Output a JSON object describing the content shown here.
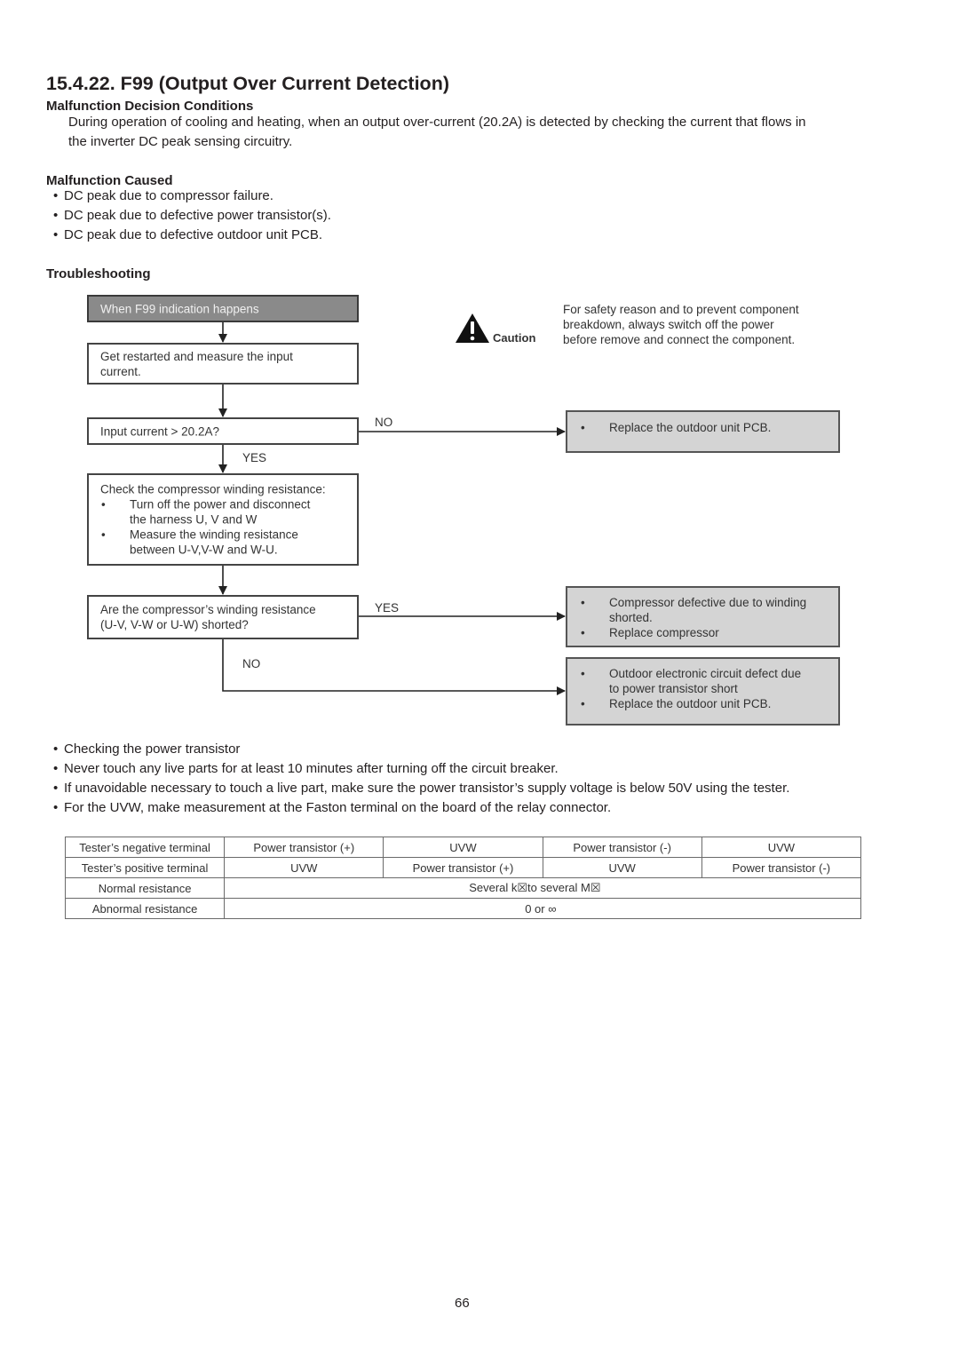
{
  "document": {
    "title": "15.4.22. F99 (Output Over Current Detection)",
    "sections": {
      "decision_conditions": {
        "heading": "Malfunction Decision Conditions",
        "text_line1": "During operation of cooling and heating, when an output over-current (20.2A) is detected by checking the current that flows in",
        "text_line2": "the inverter DC peak sensing circuitry."
      },
      "malfunction_caused": {
        "heading": "Malfunction Caused",
        "bullet": "•",
        "items": [
          "DC peak due to compressor failure.",
          "DC peak due to defective power transistor(s).",
          "DC peak due to defective outdoor unit PCB."
        ]
      },
      "troubleshooting": {
        "heading": "Troubleshooting"
      }
    },
    "caution": {
      "icon": "warning-triangle-icon",
      "label": "Caution",
      "lines": [
        "For safety reason and to prevent component",
        "breakdown, always switch off the power",
        "before remove and connect the component."
      ]
    },
    "flowchart": {
      "start": "When F99 indication happens",
      "step1": [
        "Get restarted and measure the input",
        "current."
      ],
      "decision1": "Input current >  20.2A?",
      "decision1_no_label": "NO",
      "decision1_yes_label": "YES",
      "result_no1": [
        "Replace the outdoor unit PCB."
      ],
      "step2_title": "Check the compressor winding resistance:",
      "step2_items": [
        [
          "Turn off the power and disconnect",
          "the harness U, V and W"
        ],
        [
          "Measure the winding resistance",
          "between U-V,V-W and W-U."
        ]
      ],
      "decision2": [
        "Are the compressor’s winding resistance",
        "(U-V, V-W or U-W) shorted?"
      ],
      "decision2_yes_label": "YES",
      "decision2_no_label": "NO",
      "result_yes2": [
        [
          "Compressor defective due to winding",
          "shorted."
        ],
        [
          "Replace compressor"
        ]
      ],
      "result_no2": [
        [
          "Outdoor electronic circuit defect due",
          "to power transistor short"
        ],
        [
          "Replace the outdoor unit PCB."
        ]
      ]
    },
    "power_transistor_notes": {
      "bullet": "•",
      "items": [
        "Checking the power transistor",
        "Never touch any live parts for at least 10 minutes after turning off the circuit breaker.",
        "If unavoidable necessary to touch a live part, make sure the power transistor’s supply voltage is below 50V using the tester.",
        "For the UVW, make measurement at the Faston terminal on the board of the relay connector."
      ]
    },
    "resistance_table": {
      "rows": [
        {
          "label": "Tester’s negative terminal",
          "cells": [
            "Power transistor (+)",
            "UVW",
            "Power transistor (-)",
            "UVW"
          ]
        },
        {
          "label": "Tester’s positive terminal",
          "cells": [
            "UVW",
            "Power transistor (+)",
            "UVW",
            "Power transistor (-)"
          ]
        },
        {
          "label": "Normal resistance",
          "value": "Several k☒to several M☒"
        },
        {
          "label": "Abnormal resistance",
          "value": "0 or ∞"
        }
      ]
    },
    "page_number": "66"
  }
}
